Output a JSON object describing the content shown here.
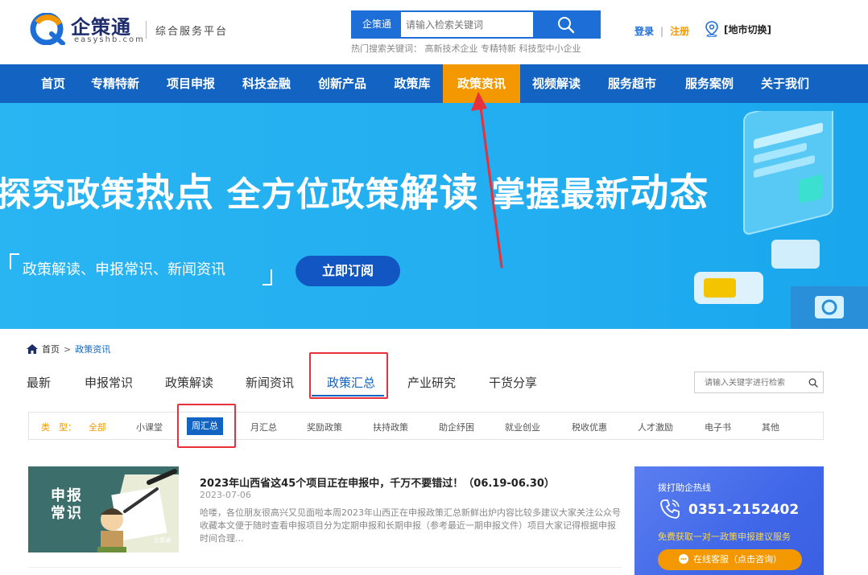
{
  "header": {
    "logo_text": "企策通",
    "logo_sub": "easyshb.com",
    "slogan": "综合服务平台",
    "search_tag": "企策通",
    "search_placeholder": "请输入检索关键词",
    "hot_words": "热门搜索关键词：  高新技术企业 专精特新 科技型中小企业",
    "login": "登录",
    "separator": "|",
    "register": "注册",
    "location": "[地市切换]"
  },
  "nav": {
    "items": [
      "首页",
      "专精特新",
      "项目申报",
      "科技金融",
      "创新产品",
      "政策库",
      "政策资讯",
      "视频解读",
      "服务超市",
      "服务案例",
      "关于我们"
    ],
    "active": "政策资讯"
  },
  "banner": {
    "headline_parts": [
      "探究政策",
      "热点",
      " 全方位政策",
      "解读",
      " 掌握最新",
      "动态"
    ],
    "subtitle": "政策解读、申报常识、新闻资讯",
    "button": "立即订阅"
  },
  "breadcrumb": {
    "home": "首页",
    "sep": ">",
    "current": "政策资讯"
  },
  "category_tabs": [
    "最新",
    "申报常识",
    "政策解读",
    "新闻资讯",
    "政策汇总",
    "产业研究",
    "干货分享"
  ],
  "active_category": "政策汇总",
  "list_search_placeholder": "请输入关键字进行检索",
  "type_filter": {
    "label": "类　型：",
    "items": [
      "全部",
      "小课堂",
      "周汇总",
      "月汇总",
      "奖励政策",
      "扶持政策",
      "助企纾困",
      "就业创业",
      "税收优惠",
      "人才激励",
      "电子书",
      "其他"
    ],
    "active": "周汇总"
  },
  "article": {
    "thumb_text": [
      "申报",
      "常识"
    ],
    "thumb_logo": "企策通",
    "title": "2023年山西省这45个项目正在申报中，千万不要错过！（06.19-06.30）",
    "date": "2023-07-06",
    "summary": "哈喽，各位朋友很高兴又见面啦本周2023年山西正在申报政策汇总新鲜出炉内容比较多建议大家关注公众号收藏本文便于随时查看申报项目分为定期申报和长期申报（参考最近一期申报文件）项目大家记得根据申报时间合理..."
  },
  "hotline": {
    "label": "拨打助企热线",
    "number": "0351-2152402",
    "desc": "免费获取一对一政策申报建议服务",
    "button": "在线客服（点击咨询）"
  },
  "colors": {
    "brand_blue": "#1263c2",
    "accent_orange": "#f39800",
    "annotation_red": "#e8303a",
    "banner_blue": "#22aef0"
  }
}
